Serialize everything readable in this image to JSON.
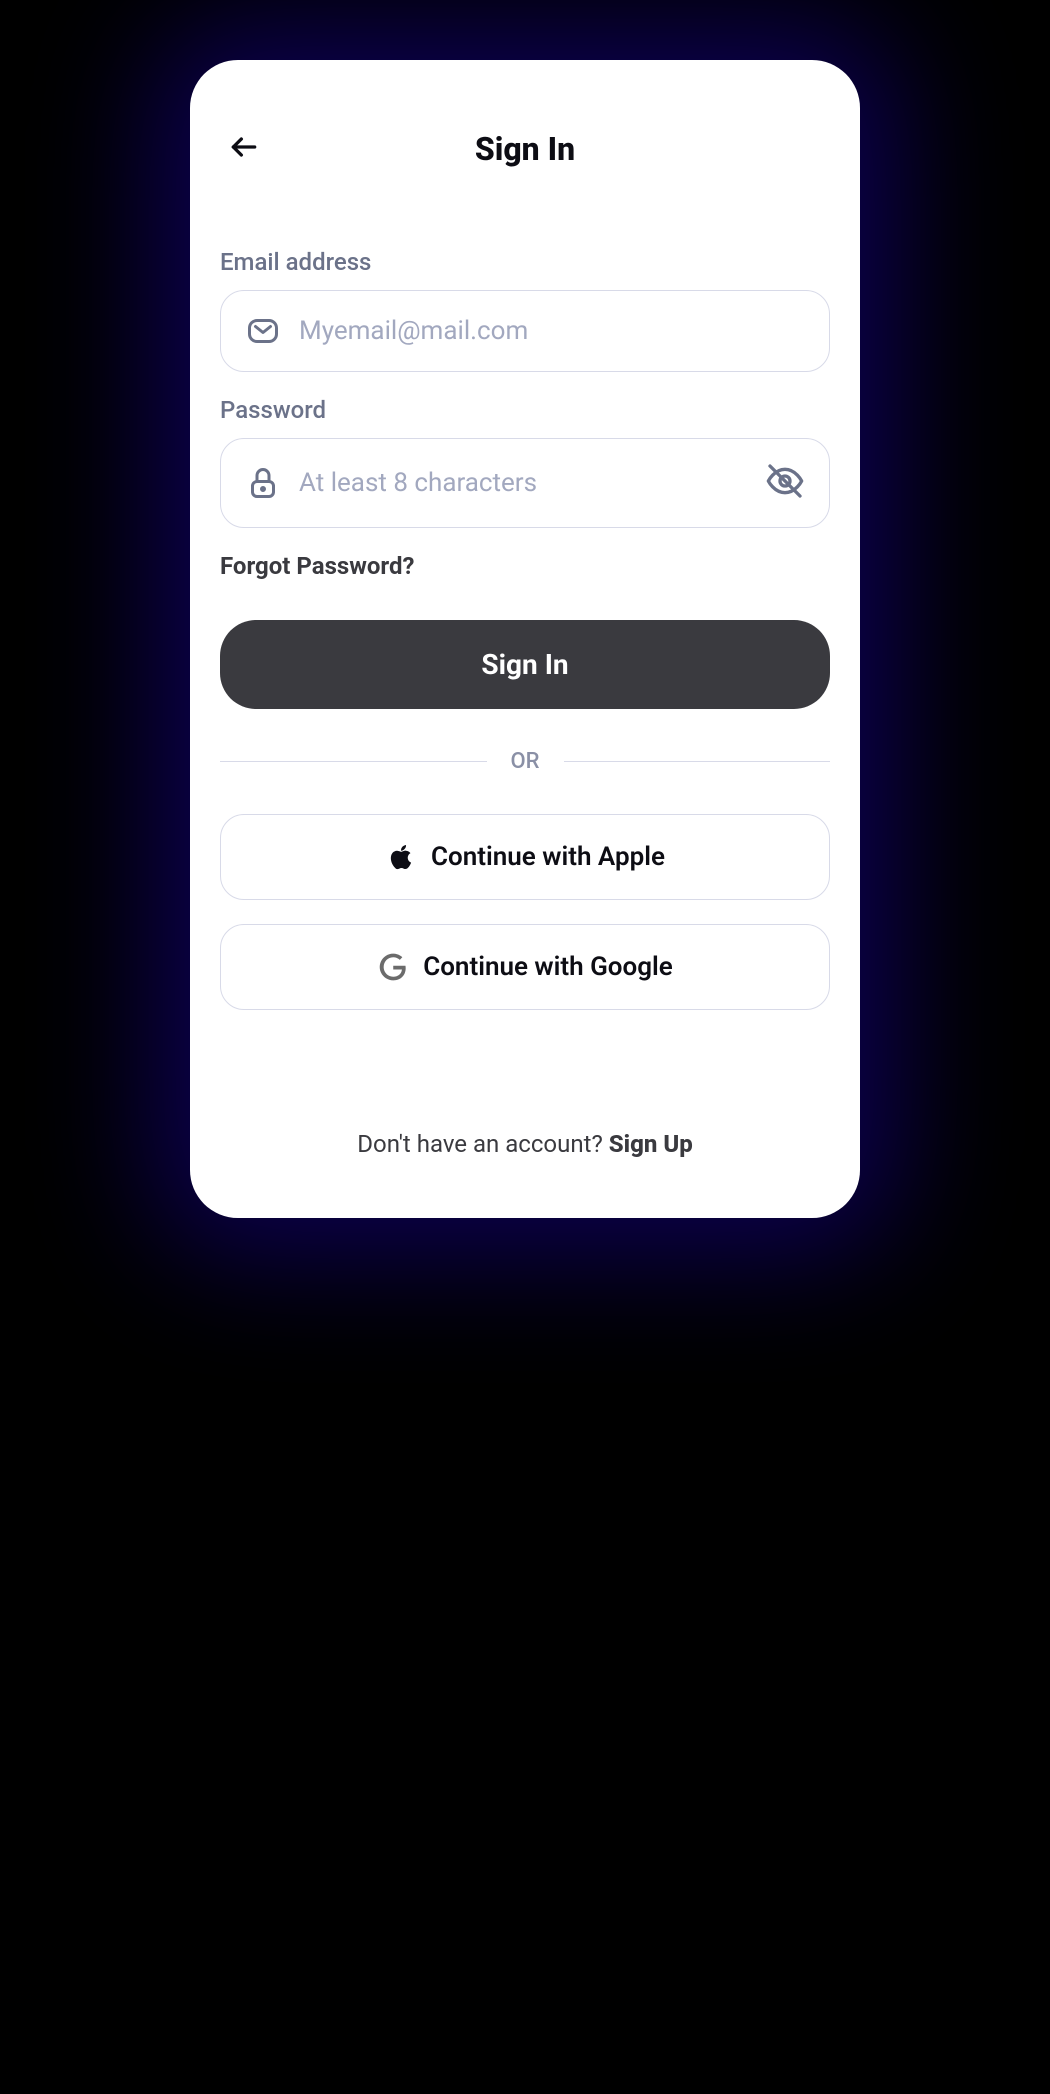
{
  "header": {
    "title": "Sign In"
  },
  "email": {
    "label": "Email address",
    "placeholder": "Myemail@mail.com",
    "value": ""
  },
  "password": {
    "label": "Password",
    "placeholder": "At least 8 characters",
    "value": ""
  },
  "forgot_password_text": "Forgot Password?",
  "signin_button_label": "Sign In",
  "divider_text": "OR",
  "social": {
    "apple_label": "Continue with Apple",
    "google_label": "Continue with Google"
  },
  "footer": {
    "prompt": "Don't have an account? ",
    "signup_label": "Sign Up"
  }
}
